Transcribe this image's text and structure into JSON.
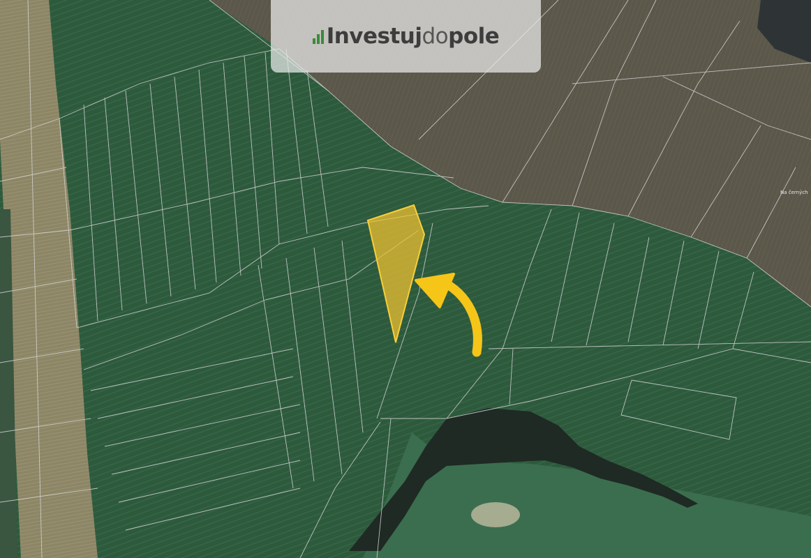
{
  "logo": {
    "brand_part1": "Investuj",
    "brand_part2": "do",
    "brand_part3": "pole",
    "icon": "bar-chart-icon"
  },
  "map": {
    "type": "satellite-cadastral-map",
    "place_label": "Na černých",
    "highlight_color": "#f2c230",
    "arrow_color": "#f5c518",
    "parcel_line_color": "#d8d8d8",
    "field_green": "#2f5a3d",
    "plowed_brown": "#5a5646"
  }
}
